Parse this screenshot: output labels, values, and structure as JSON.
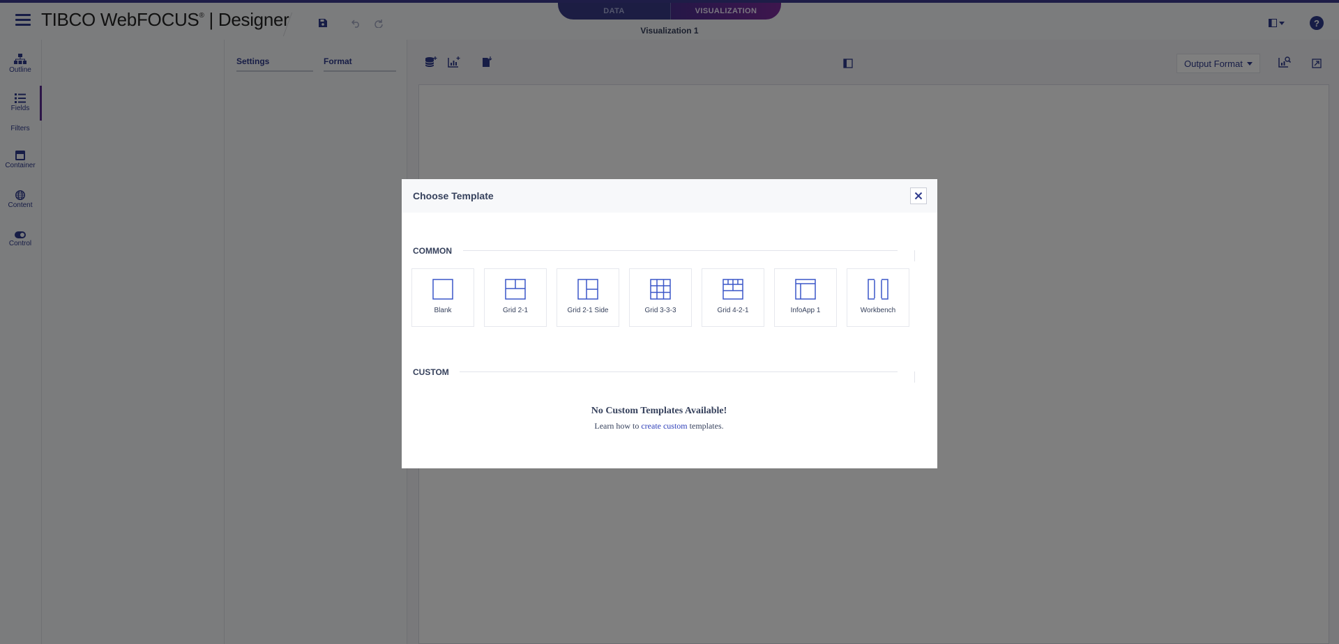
{
  "app": {
    "brand_name": "TIBCO WebFOCUS",
    "brand_reg": "®",
    "product": "| Designer",
    "doc_title": "Visualization 1"
  },
  "header": {
    "tabs": [
      {
        "label": "DATA"
      },
      {
        "label": "VISUALIZATION"
      }
    ],
    "help_label": "?"
  },
  "leftnav": {
    "items": [
      {
        "label": "Outline",
        "icon": "outline-icon"
      },
      {
        "label": "Fields",
        "icon": "fields-icon"
      },
      {
        "label": "Filters",
        "icon": "filters-icon"
      },
      {
        "label": "Container",
        "icon": "container-icon"
      },
      {
        "label": "Content",
        "icon": "content-icon"
      },
      {
        "label": "Control",
        "icon": "control-icon"
      }
    ]
  },
  "settings_panel": {
    "tabs": [
      {
        "label": "Settings"
      },
      {
        "label": "Format"
      }
    ]
  },
  "toolbar": {
    "output_format_label": "Output Format"
  },
  "modal": {
    "title": "Choose Template",
    "common_label": "COMMON",
    "custom_label": "CUSTOM",
    "templates": [
      {
        "label": "Blank",
        "icon": "blank-template-icon"
      },
      {
        "label": "Grid 2-1",
        "icon": "grid-2-1-template-icon"
      },
      {
        "label": "Grid 2-1 Side",
        "icon": "grid-2-1-side-template-icon"
      },
      {
        "label": "Grid 3-3-3",
        "icon": "grid-3-3-3-template-icon"
      },
      {
        "label": "Grid 4-2-1",
        "icon": "grid-4-2-1-template-icon"
      },
      {
        "label": "InfoApp 1",
        "icon": "infoapp-1-template-icon"
      },
      {
        "label": "Workbench",
        "icon": "workbench-template-icon"
      }
    ],
    "empty_title": "No Custom Templates Available!",
    "empty_prefix": "Learn how to",
    "empty_link": "create custom",
    "empty_suffix": "templates."
  },
  "colors": {
    "accent": "#2e3a8c",
    "tab_data": "#383a86",
    "tab_viz": "#6a2d98",
    "template_icon": "#3a56c8"
  }
}
